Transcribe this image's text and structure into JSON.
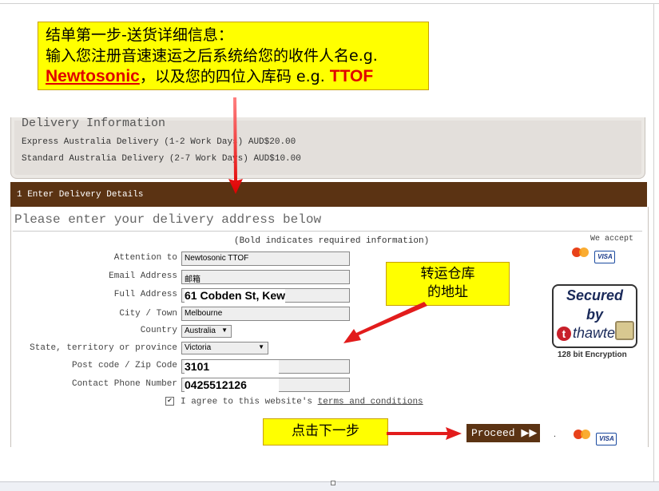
{
  "callout_top": {
    "line1": "结单第一步-送货详细信息：",
    "line2": "输入您注册音速速运之后系统给您的收件人名e.g.",
    "line3_name": "Newtosonic",
    "line3_mid": "，以及您的四位入库码   e.g. ",
    "line3_code": "TTOF"
  },
  "delivery": {
    "title": "Delivery Information",
    "express": "Express Australia Delivery (1-2 Work Days) AUD$20.00",
    "standard": "Standard Australia Delivery (2-7 Work Days) AUD$10.00"
  },
  "step_bar": "1 Enter Delivery Details",
  "form": {
    "title": "Please enter your delivery address below",
    "note": "(Bold indicates required information)",
    "attention_label": "Attention to",
    "attention_value": "Newtosonic TTOF",
    "email_label": "Email Address",
    "email_value": "邮箱",
    "address_label": "Full Address",
    "address_value": "61 Cobden St, Kew",
    "city_label": "City / Town",
    "city_value": "Melbourne",
    "country_label": "Country",
    "country_value": "Australia",
    "state_label": "State, territory or province",
    "state_value": "Victoria",
    "postcode_label": "Post code / Zip Code",
    "postcode_value": "3101",
    "phone_label": "Contact Phone Number",
    "phone_value": "0425512126",
    "agree_text": "I agree to this website's ",
    "terms_link": "terms and conditions"
  },
  "sidebar": {
    "we_accept": "We accept",
    "mastercard": "MasterCard",
    "visa": "VISA",
    "secured": "Secured",
    "by": "by",
    "thawte": "thawte",
    "encryption": "128 bit Encryption"
  },
  "callout_warehouse": {
    "line1": "转运仓库",
    "line2": "的地址"
  },
  "callout_next": "点击下一步",
  "proceed_label": "Proceed ▶▶",
  "dot": "."
}
